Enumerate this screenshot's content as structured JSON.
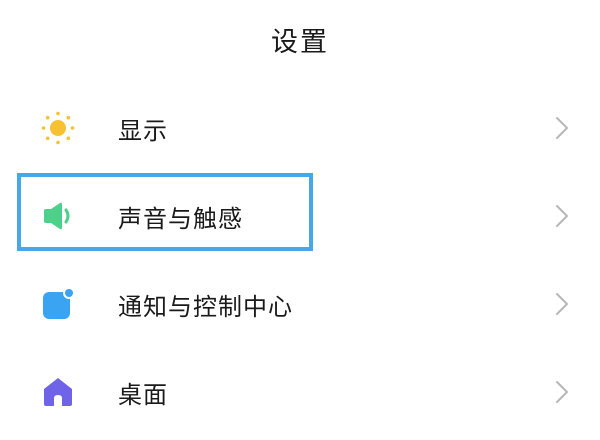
{
  "header": {
    "title": "设置"
  },
  "settings": {
    "items": [
      {
        "label": "显示",
        "icon": "sun-icon",
        "color": "#f7c232"
      },
      {
        "label": "声音与触感",
        "icon": "speaker-icon",
        "color": "#4cd08a"
      },
      {
        "label": "通知与控制中心",
        "icon": "notification-icon",
        "color": "#3aa4f2"
      },
      {
        "label": "桌面",
        "icon": "home-icon",
        "color": "#6f63e8"
      }
    ]
  },
  "highlight": {
    "target": "声音与触感",
    "color": "#46a8e8"
  }
}
